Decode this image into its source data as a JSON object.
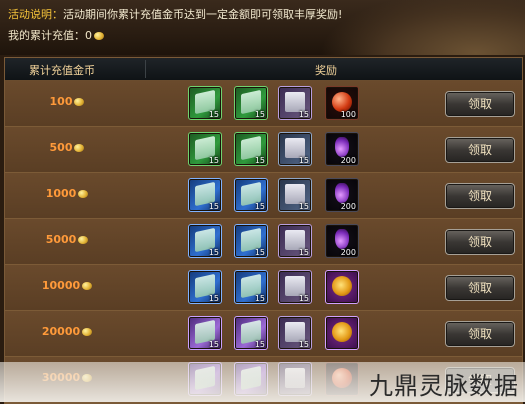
{
  "banner": {
    "activity_label": "活动说明：",
    "activity_text": "活动期间你累计充值金币达到一定金额即可领取丰厚奖励!",
    "my_topup_label": "我的累计充值：",
    "my_topup_value": "0"
  },
  "table": {
    "col_amount": "累计充值金币",
    "col_reward": "奖励",
    "claim_label": "领取",
    "rows": [
      {
        "amount": "100",
        "items": [
          {
            "icon": "green-skill-book",
            "qty": "15"
          },
          {
            "icon": "green-skill-book",
            "qty": "15"
          },
          {
            "icon": "purple-scroll",
            "qty": "15"
          },
          {
            "icon": "red-orb",
            "qty": "100"
          }
        ]
      },
      {
        "amount": "500",
        "items": [
          {
            "icon": "green-skill-book",
            "qty": "15"
          },
          {
            "icon": "green-skill-book",
            "qty": "15"
          },
          {
            "icon": "blue-scroll",
            "qty": "15"
          },
          {
            "icon": "purple-potion",
            "qty": "200"
          }
        ]
      },
      {
        "amount": "1000",
        "items": [
          {
            "icon": "blue-skill-book",
            "qty": "15"
          },
          {
            "icon": "blue-skill-book",
            "qty": "15"
          },
          {
            "icon": "blue-scroll",
            "qty": "15"
          },
          {
            "icon": "purple-potion",
            "qty": "200"
          }
        ]
      },
      {
        "amount": "5000",
        "items": [
          {
            "icon": "blue-skill-book",
            "qty": "15"
          },
          {
            "icon": "blue-skill-book",
            "qty": "15"
          },
          {
            "icon": "purple-scroll",
            "qty": "15"
          },
          {
            "icon": "purple-potion",
            "qty": "200"
          }
        ]
      },
      {
        "amount": "10000",
        "items": [
          {
            "icon": "blue-skill-book",
            "qty": "15"
          },
          {
            "icon": "blue-skill-book",
            "qty": "15"
          },
          {
            "icon": "purple-scroll",
            "qty": "15"
          },
          {
            "icon": "gold-sun-emblem",
            "qty": ""
          }
        ]
      },
      {
        "amount": "20000",
        "items": [
          {
            "icon": "purple-skill-book",
            "qty": "15"
          },
          {
            "icon": "purple-skill-book",
            "qty": "15"
          },
          {
            "icon": "purple-scroll",
            "qty": "15"
          },
          {
            "icon": "gold-sun-emblem",
            "qty": ""
          }
        ]
      },
      {
        "amount": "30000",
        "items": [
          {
            "icon": "purple-skill-book",
            "qty": ""
          },
          {
            "icon": "purple-skill-book",
            "qty": ""
          },
          {
            "icon": "purple-scroll",
            "qty": ""
          },
          {
            "icon": "orange-orb",
            "qty": ""
          }
        ]
      }
    ]
  },
  "watermark": "九鼎灵脉数据"
}
